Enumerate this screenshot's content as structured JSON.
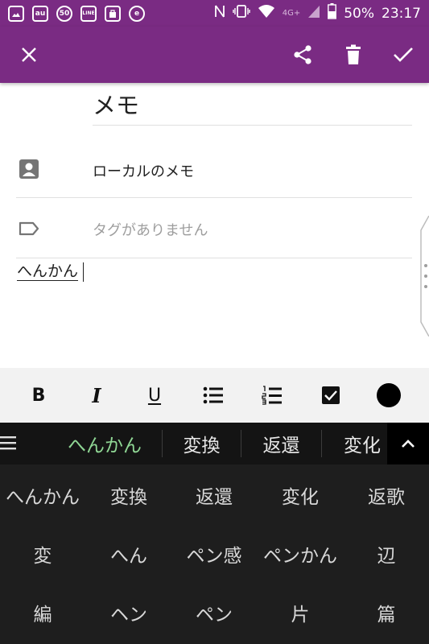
{
  "status_bar": {
    "left_icons": [
      "image-icon",
      "au-icon",
      "50-icon",
      "line-icon",
      "bag-icon",
      "e-icon"
    ],
    "left_labels": [
      "au",
      "50",
      "LINE",
      "e"
    ],
    "network": "4G+",
    "battery": "50%",
    "time": "23:17"
  },
  "toolbar": {
    "close_icon": "close-icon",
    "share_icon": "share-icon",
    "delete_icon": "trash-icon",
    "save_icon": "check-icon"
  },
  "note": {
    "title": "メモ",
    "notebook": "ローカルのメモ",
    "tags_placeholder": "タグがありません",
    "body": "へんかん"
  },
  "format_bar": {
    "bold": "B",
    "italic": "I",
    "underline": "U",
    "color": "#000000"
  },
  "keyboard": {
    "candidate_bar": [
      "へんかん",
      "変換",
      "返還",
      "変化"
    ],
    "candidate_grid": [
      [
        "へんかん",
        "変換",
        "返還",
        "変化",
        "返歌"
      ],
      [
        "変",
        "へん",
        "ペン感",
        "ペンかん",
        "辺"
      ],
      [
        "編",
        "ヘン",
        "ペン",
        "片",
        "篇"
      ]
    ],
    "accent": "#8fd694"
  },
  "colors": {
    "app_bar": "#7a2b83",
    "keyboard_bg": "#1e1e1e"
  }
}
